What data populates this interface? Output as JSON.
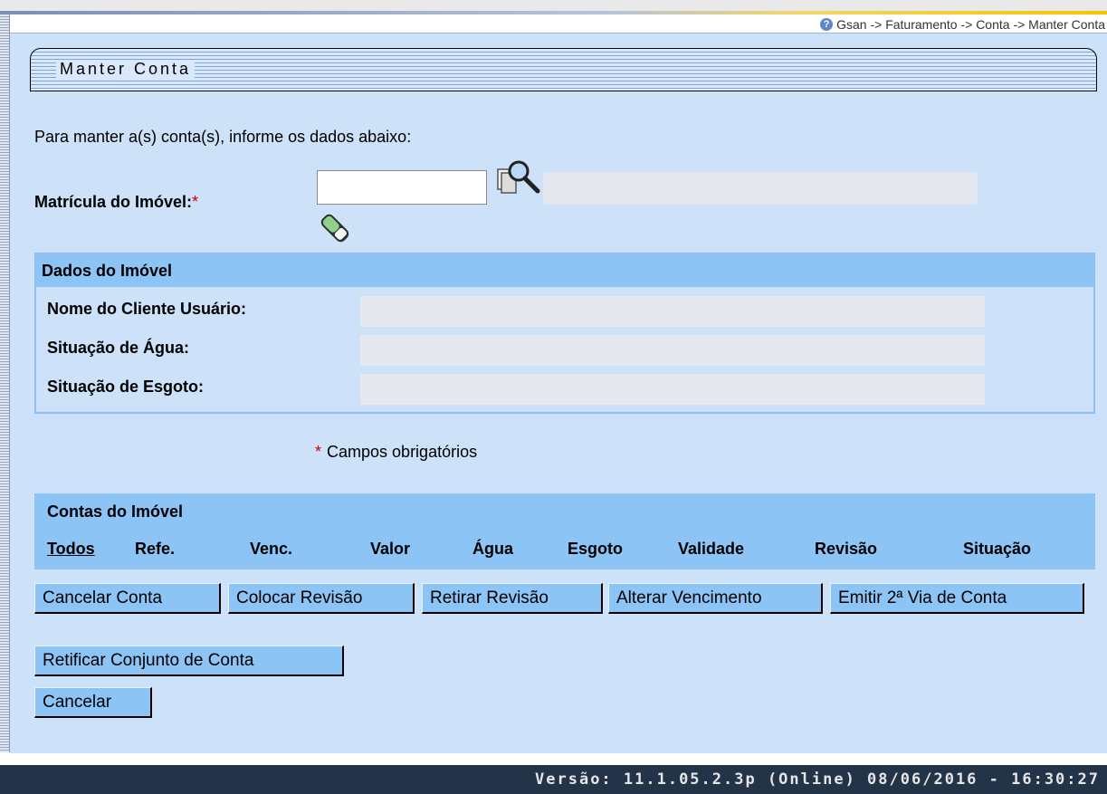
{
  "breadcrumb": {
    "text": "Gsan -> Faturamento -> Conta -> Manter Conta",
    "icon": "help-icon"
  },
  "page": {
    "title": "Manter Conta",
    "intro": "Para manter a(s) conta(s), informe os dados abaixo:"
  },
  "matricula": {
    "label": "Matrícula do Imóvel:",
    "required_marker": "*",
    "value": "",
    "description": ""
  },
  "dados_imovel": {
    "header": "Dados do Imóvel",
    "rows": [
      {
        "label": "Nome do Cliente Usuário:",
        "value": ""
      },
      {
        "label": "Situação de Água:",
        "value": ""
      },
      {
        "label": "Situação de Esgoto:",
        "value": ""
      }
    ]
  },
  "required_note": {
    "marker": "*",
    "text": "Campos obrigatórios"
  },
  "contas_imovel": {
    "header": "Contas do Imóvel",
    "columns": [
      "Todos",
      "Refe.",
      "Venc.",
      "Valor",
      "Água",
      "Esgoto",
      "Validade",
      "Revisão",
      "Situação"
    ]
  },
  "buttons": {
    "cancelar_conta": "Cancelar Conta",
    "colocar_revisao": "Colocar Revisão",
    "retirar_revisao": "Retirar Revisão",
    "alterar_vencimento": "Alterar Vencimento",
    "emitir_2via": "Emitir 2ª Via de Conta",
    "retificar_conjunto": "Retificar Conjunto de Conta",
    "cancelar": "Cancelar"
  },
  "footer": {
    "version": "Versão: 11.1.05.2.3p (Online) 08/06/2016 - 16:30:27"
  },
  "colors": {
    "panel": "#cde1f8",
    "section_header": "#8cc4f6",
    "footer": "#233449",
    "required": "#cc0000"
  }
}
